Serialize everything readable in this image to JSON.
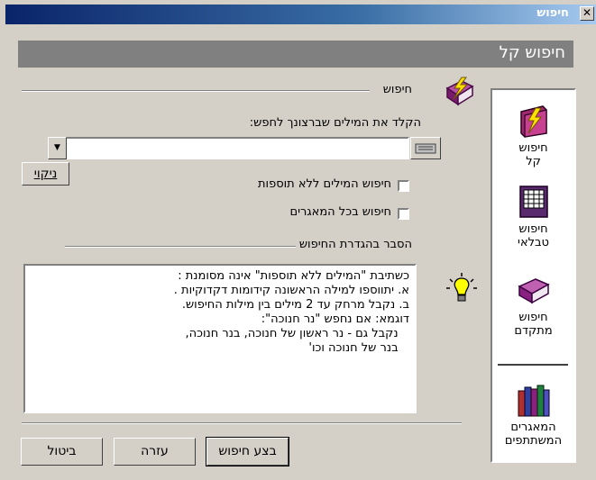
{
  "window": {
    "title": "חיפוש",
    "close_glyph": "✕"
  },
  "header": {
    "title": "חיפוש קל"
  },
  "search_group": {
    "label": "חיפוש",
    "prompt": "הקלד את המילים שברצונך לחפש:",
    "input_value": "",
    "clear_button": "ניקוי",
    "checkbox_exact": {
      "label": "חיפוש המילים ללא תוספות",
      "checked": false
    },
    "checkbox_all_db": {
      "label": "חיפוש בכל המאגרים",
      "checked": false
    }
  },
  "explain_group": {
    "label": "הסבר בהגדרת החיפוש",
    "lines": [
      "כשתיבת \"המילים ללא תוספות\" אינה מסומנת :",
      "",
      "א. יתווספו למילה הראשונה קידומות דקדוקיות .",
      "",
      "ב. נקבל מרחק עד 2 מילים בין מילות החיפוש.",
      "",
      "דוגמא: אם נחפש \"נר חנוכה\":",
      "   נקבל גם - נר ראשון של חנוכה, בנר חנוכה,",
      "   בנר של חנוכה וכו'"
    ]
  },
  "buttons": {
    "search": "בצע חיפוש",
    "help": "עזרה",
    "cancel": "ביטול"
  },
  "side_panel": [
    {
      "line1": "חיפוש",
      "line2": "קל",
      "icon": "lightning-book-icon"
    },
    {
      "line1": "חיפוש",
      "line2": "טבלאי",
      "icon": "table-book-icon"
    },
    {
      "line1": "חיפוש",
      "line2": "מתקדם",
      "icon": "purple-book-icon"
    },
    {
      "line1": "המאגרים",
      "line2": "המשתתפים",
      "icon": "books-icon"
    }
  ]
}
